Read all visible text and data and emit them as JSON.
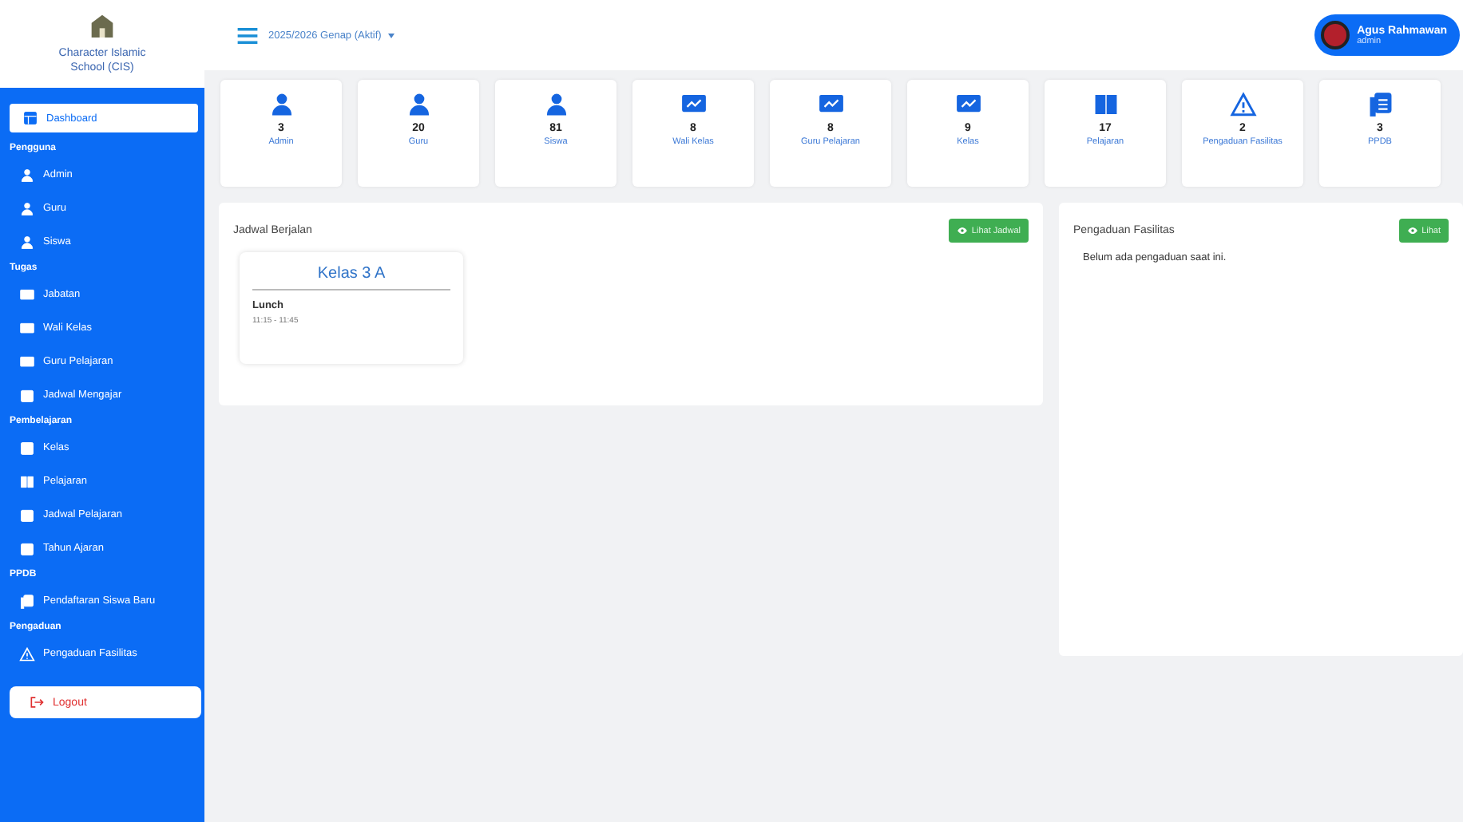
{
  "sidebar": {
    "brand": "Character Islamic School (CIS)",
    "sections": [
      {
        "kind": "link",
        "label": "Dashboard",
        "selected": true
      },
      {
        "kind": "heading",
        "label": "Pengguna"
      },
      {
        "kind": "link",
        "label": "Admin",
        "selected": false
      },
      {
        "kind": "link",
        "label": "Guru",
        "selected": false
      },
      {
        "kind": "link",
        "label": "Siswa",
        "selected": false
      },
      {
        "kind": "heading",
        "label": "Tugas"
      },
      {
        "kind": "link",
        "label": "Jabatan",
        "selected": false
      },
      {
        "kind": "link",
        "label": "Wali Kelas",
        "selected": false
      },
      {
        "kind": "link",
        "label": "Guru Pelajaran",
        "selected": false
      },
      {
        "kind": "link",
        "label": "Jadwal Mengajar",
        "selected": false
      },
      {
        "kind": "heading",
        "label": "Pembelajaran"
      },
      {
        "kind": "link",
        "label": "Kelas",
        "selected": false
      },
      {
        "kind": "link",
        "label": "Pelajaran",
        "selected": false
      },
      {
        "kind": "link",
        "label": "Jadwal Pelajaran",
        "selected": false
      },
      {
        "kind": "link",
        "label": "Tahun Ajaran",
        "selected": false
      },
      {
        "kind": "heading",
        "label": "PPDB"
      },
      {
        "kind": "link",
        "label": "Pendaftaran Siswa Baru",
        "selected": false
      },
      {
        "kind": "heading",
        "label": "Pengaduan"
      },
      {
        "kind": "link",
        "label": "Pengaduan Fasilitas",
        "selected": false
      }
    ],
    "logout": "Logout"
  },
  "header": {
    "semester": "2025/2026 Genap (Aktif)",
    "user": {
      "name": "Agus Rahmawan",
      "role": "admin"
    }
  },
  "stats": [
    {
      "value": "3",
      "label": "Admin"
    },
    {
      "value": "20",
      "label": "Guru"
    },
    {
      "value": "81",
      "label": "Siswa"
    },
    {
      "value": "8",
      "label": "Wali Kelas"
    },
    {
      "value": "8",
      "label": "Guru Pelajaran"
    },
    {
      "value": "9",
      "label": "Kelas"
    },
    {
      "value": "17",
      "label": "Pelajaran"
    },
    {
      "value": "2",
      "label": "Pengaduan Fasilitas"
    },
    {
      "value": "3",
      "label": "PPDB"
    }
  ],
  "schedule": {
    "title": "Jadwal Berjalan",
    "button": "Lihat Jadwal",
    "cards": [
      {
        "class": "Kelas 3 A",
        "subject": "Lunch",
        "time": "11:15 - 11:45"
      }
    ]
  },
  "complaints": {
    "title": "Pengaduan Fasilitas",
    "button": "Lihat",
    "empty": "Belum ada pengaduan saat ini."
  }
}
